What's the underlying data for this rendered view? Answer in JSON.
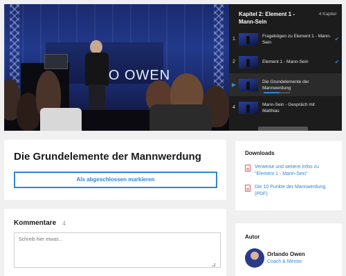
{
  "video": {
    "banner_text": "NDO OWEN"
  },
  "playlist": {
    "chapter_title": "Kapitel 2: Element 1 - Mann-Sein",
    "chapter_count": "4 Kapitel",
    "items": [
      {
        "num": "1",
        "label": "Fragebögen zu Element 1 - Mann-Sein",
        "status": "done"
      },
      {
        "num": "2",
        "label": "Element 1 - Mann-Sein",
        "status": "done"
      },
      {
        "num": "",
        "label": "Die Grundelemente der Mannwerdung",
        "status": "playing",
        "progress": 0.6
      },
      {
        "num": "4",
        "label": "Mann-Sein - Gespräch mit Matthias",
        "status": "open"
      }
    ]
  },
  "lesson": {
    "title": "Die Grundelemente der Mannwerdung",
    "complete_button": "Als abgeschlossen markieren"
  },
  "comments": {
    "title": "Kommentare",
    "count": "4",
    "placeholder": "Schreib hier etwas..."
  },
  "downloads": {
    "title": "Downloads",
    "items": [
      {
        "label": "Verweise und weitere Infos zu \"Element 1 - Mann-Sein\"",
        "icon": "pdf-file-icon"
      },
      {
        "label": "Die 10 Punkte der Mannwerdung (PDF)",
        "icon": "pdf-file-icon"
      }
    ]
  },
  "author": {
    "title": "Autor",
    "name": "Orlando Owen",
    "role": "Coach & Mentor"
  },
  "colors": {
    "accent": "#2f86d6",
    "pdf_icon": "#e06060",
    "playlist_bg": "#1c1c1c"
  }
}
